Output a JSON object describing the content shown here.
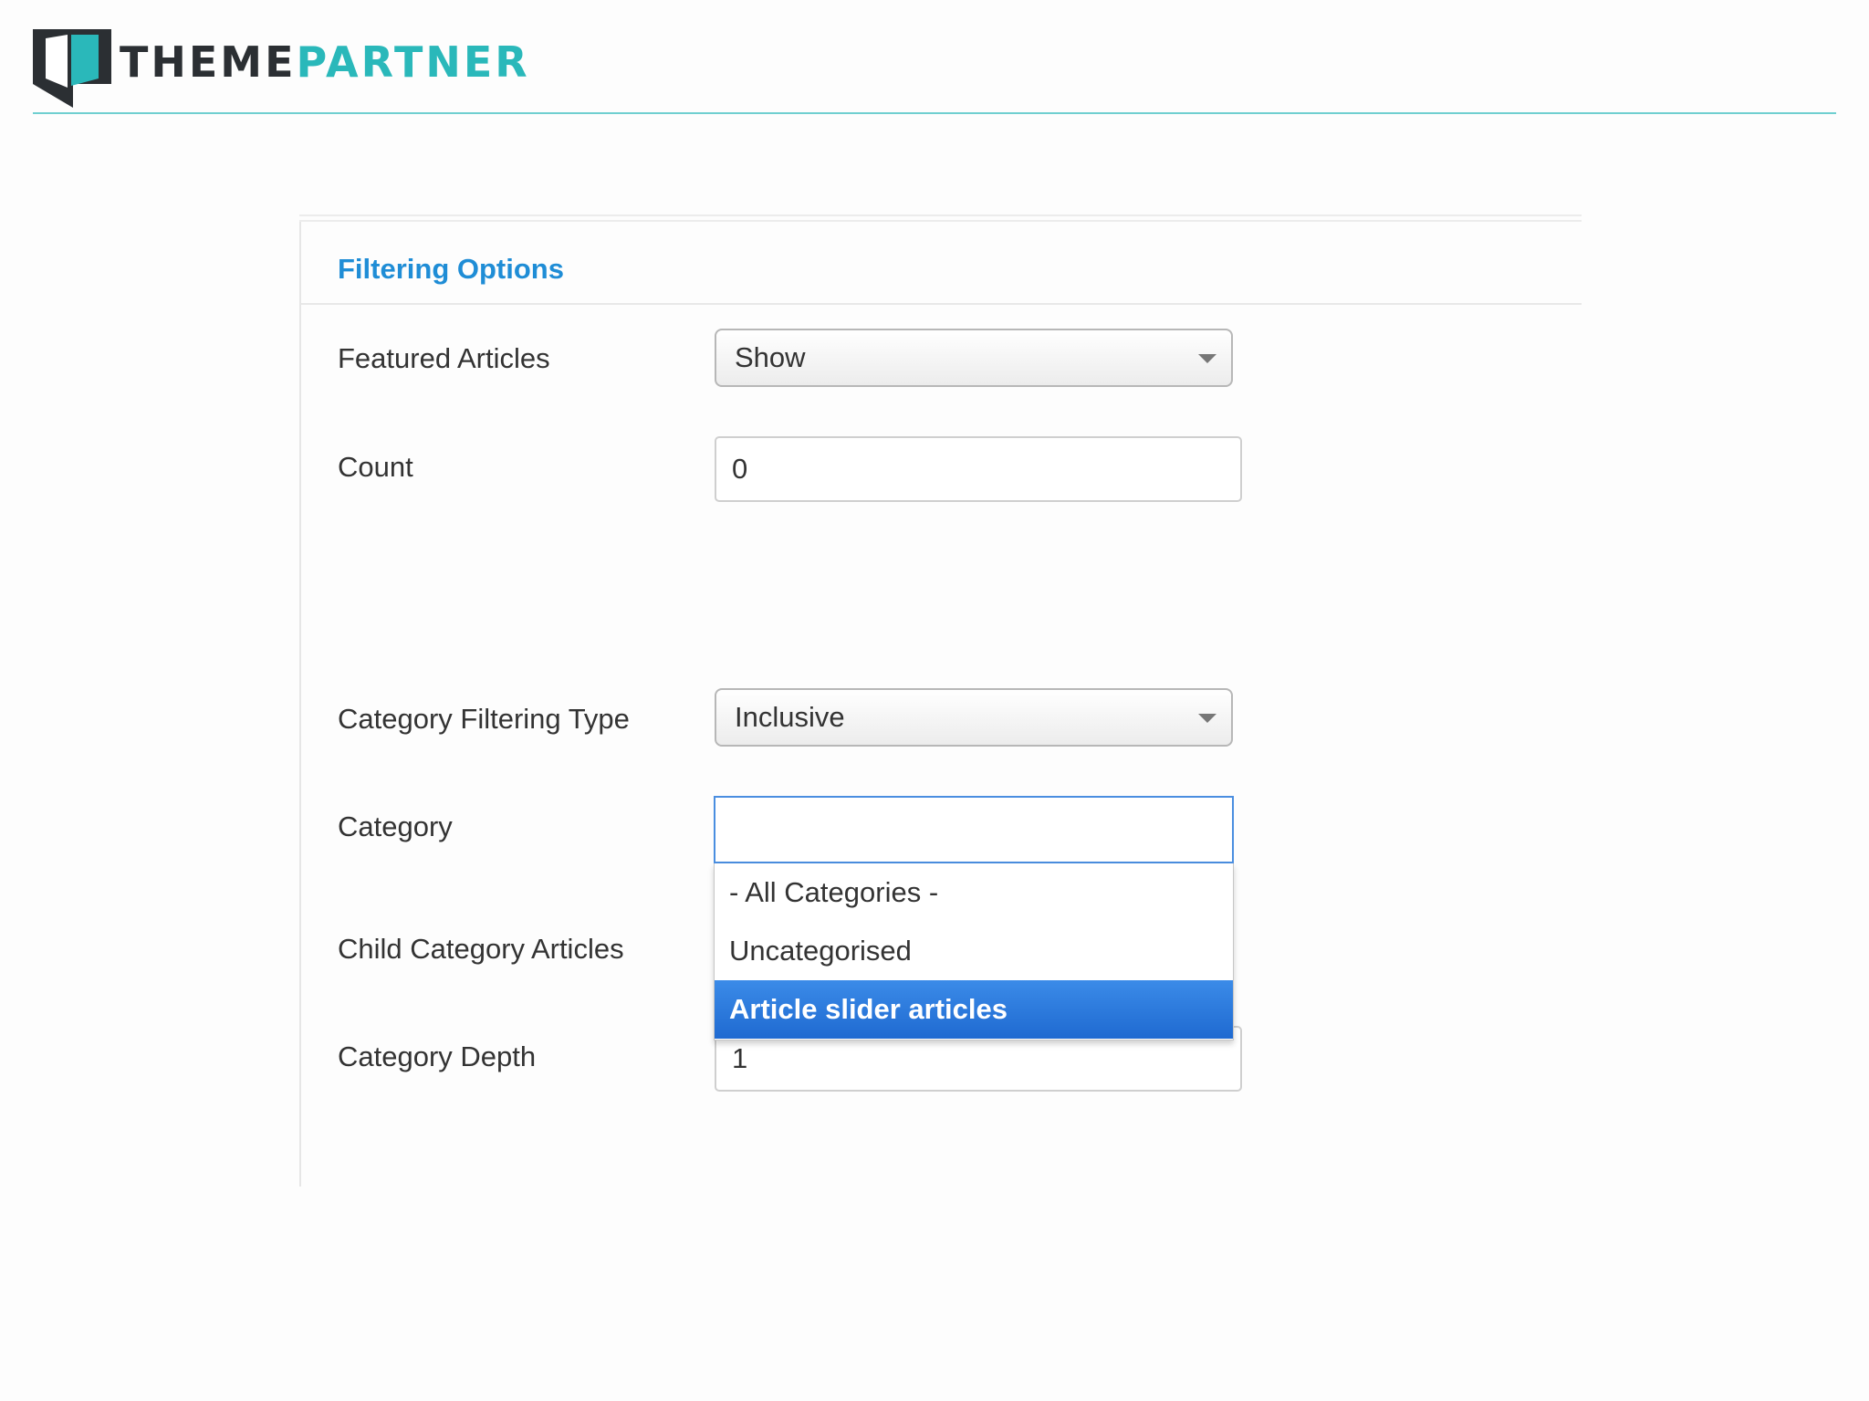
{
  "brand": {
    "name_part1": "THEME",
    "name_part2": "PARTNER",
    "colors": {
      "dark": "#2b2f33",
      "accent": "#2ab8ba"
    },
    "icon": "themepartner-logo-icon"
  },
  "panel": {
    "title": "Filtering Options",
    "title_color": "#1f8dd6"
  },
  "fields": {
    "featured_articles": {
      "label": "Featured Articles",
      "value": "Show"
    },
    "count": {
      "label": "Count",
      "value": "0"
    },
    "category_filtering_type": {
      "label": "Category Filtering Type",
      "value": "Inclusive"
    },
    "category": {
      "label": "Category",
      "search_value": "",
      "options": [
        "- All Categories -",
        "Uncategorised",
        "Article slider articles"
      ],
      "highlighted_option": "Article slider articles",
      "highlight_color": "#2a7bdc"
    },
    "child_category_articles": {
      "label": "Child Category Articles"
    },
    "category_depth": {
      "label": "Category Depth",
      "value": "1"
    }
  }
}
